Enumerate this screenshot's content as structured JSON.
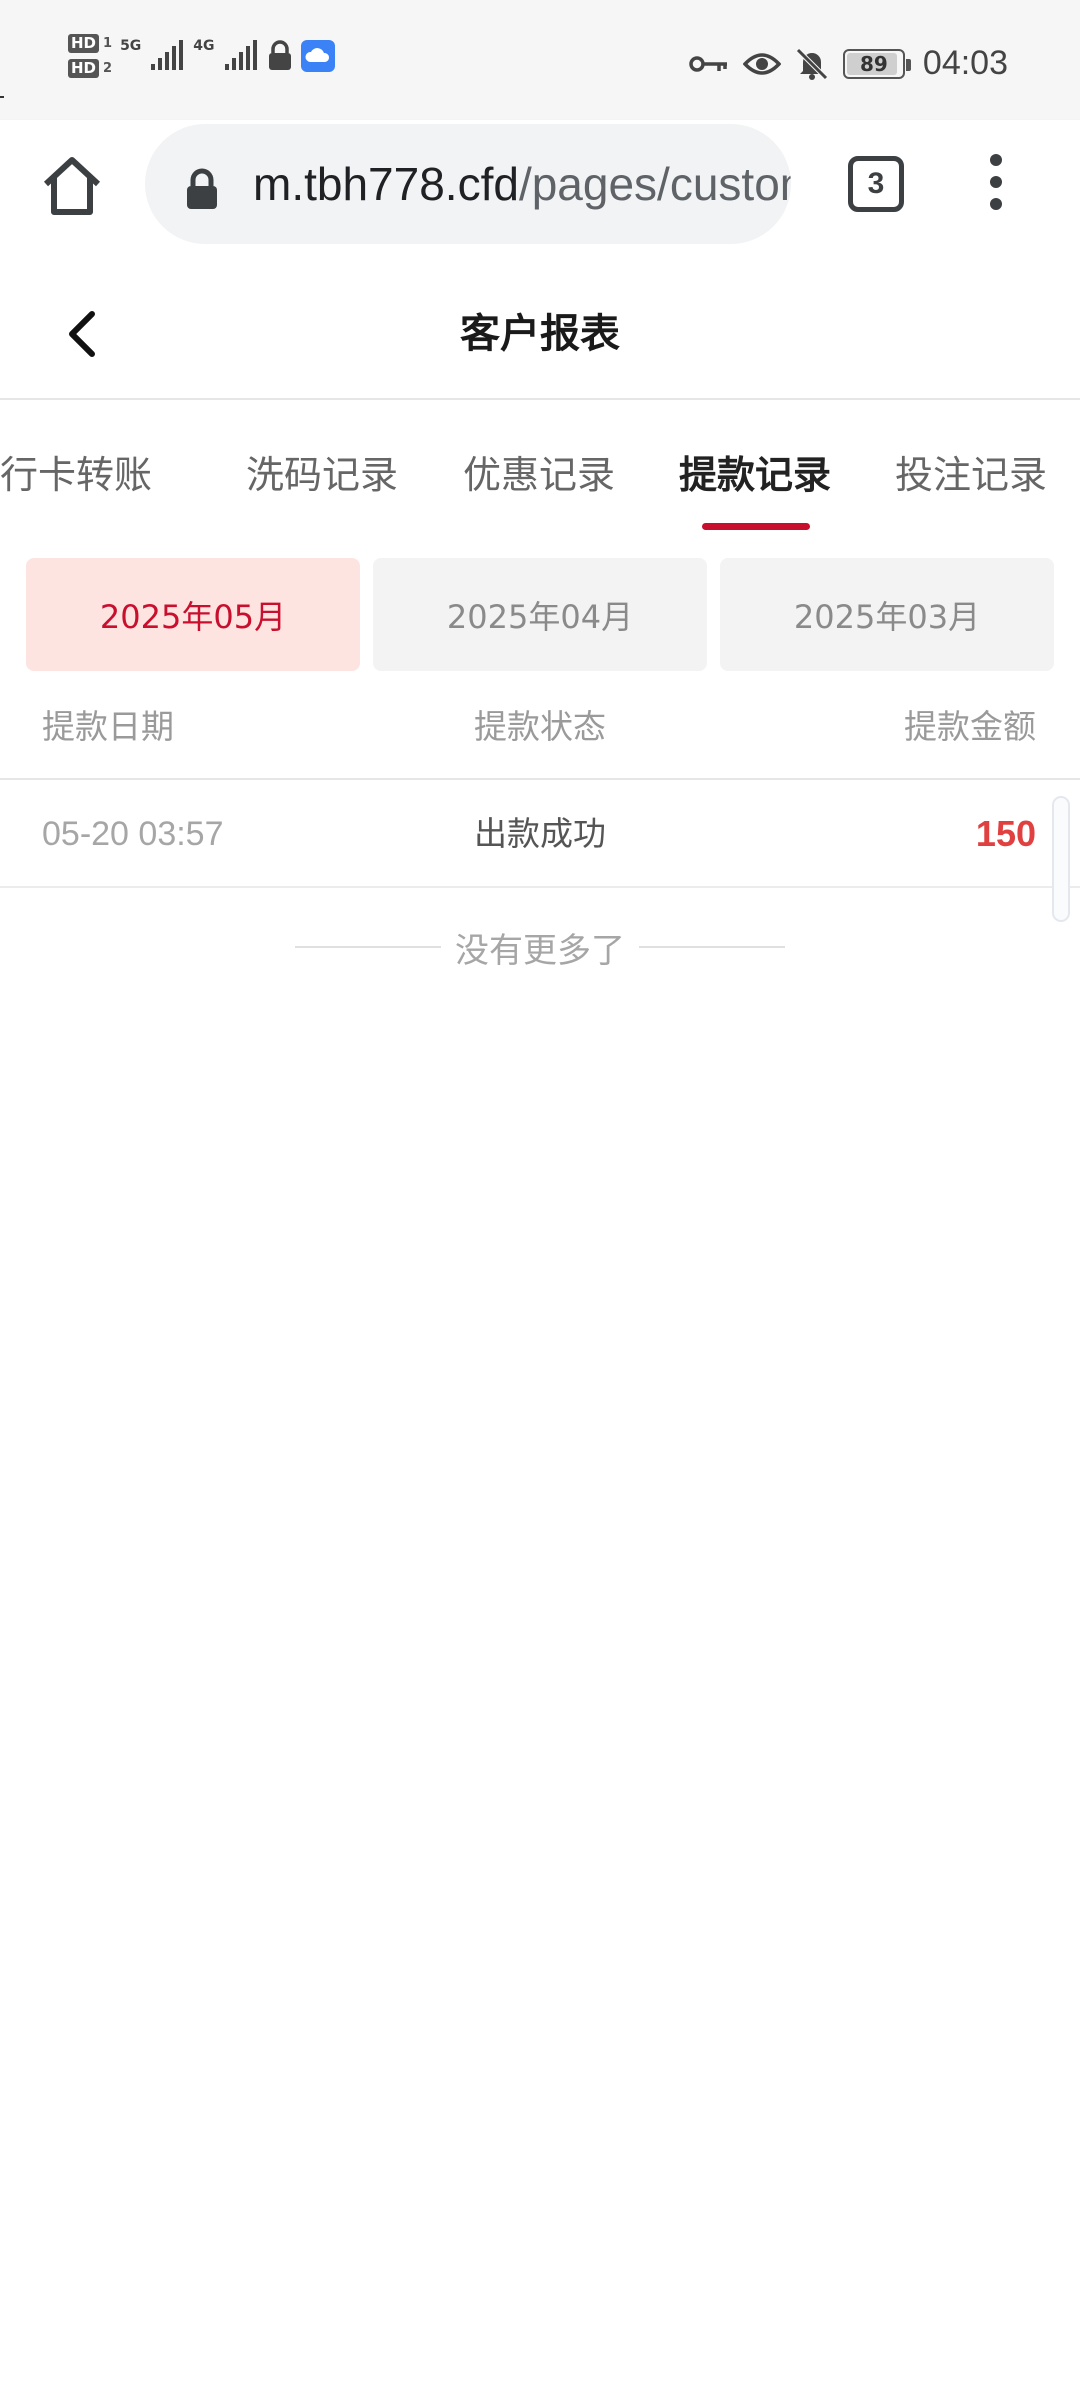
{
  "status_bar": {
    "hd1": "HD",
    "hd1_sub": "1",
    "hd2": "HD",
    "hd2_sub": "2",
    "net1": "5G",
    "net2": "4G",
    "battery_level": 89,
    "battery_text": "89",
    "time": "04:03",
    "icons": [
      "signal-icon",
      "lock-icon",
      "cloud-icon",
      "key-icon",
      "eye-icon",
      "bell-off-icon",
      "battery-icon"
    ]
  },
  "browser": {
    "url_host": "m.tbh778.cfd",
    "url_path": "/pages/customer",
    "tab_count": "3"
  },
  "header": {
    "title": "客户报表"
  },
  "tabs": [
    {
      "label": "银行卡转账",
      "active": false
    },
    {
      "label": "洗码记录",
      "active": false
    },
    {
      "label": "优惠记录",
      "active": false
    },
    {
      "label": "提款记录",
      "active": true
    },
    {
      "label": "投注记录",
      "active": false
    }
  ],
  "months": [
    {
      "label": "2025年05月",
      "active": true
    },
    {
      "label": "2025年04月",
      "active": false
    },
    {
      "label": "2025年03月",
      "active": false
    }
  ],
  "table": {
    "headers": [
      "提款日期",
      "提款状态",
      "提款金额"
    ],
    "rows": [
      {
        "date": "05-20 03:57",
        "status": "出款成功",
        "amount": "150"
      }
    ]
  },
  "no_more_text": "没有更多了",
  "colors": {
    "accent": "#c8102e",
    "amount": "#e0403f",
    "active_chip_bg": "#fde4e1"
  }
}
